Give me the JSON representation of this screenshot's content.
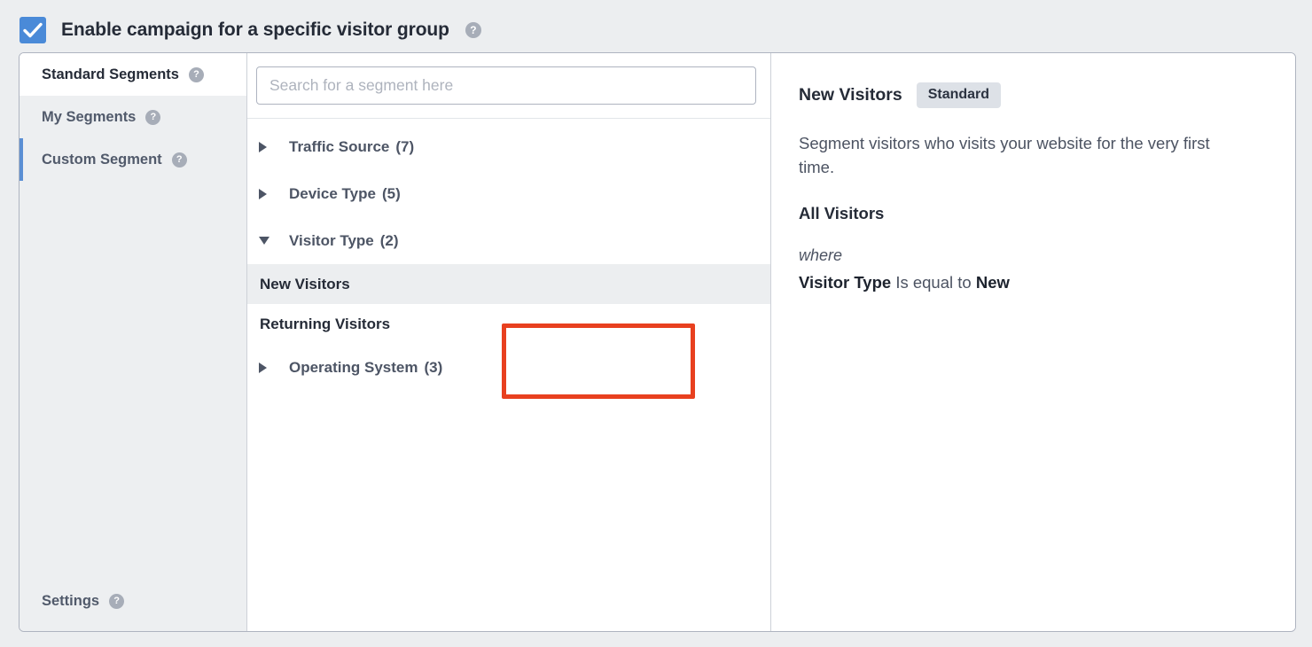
{
  "enable": {
    "label": "Enable campaign for a specific visitor group",
    "checked": true,
    "help": "?",
    "checkbox_color": "#4a8ad8"
  },
  "sidebar": {
    "items": [
      {
        "label": "Standard Segments",
        "help": "?",
        "active": true,
        "marked": false
      },
      {
        "label": "My Segments",
        "help": "?",
        "active": false,
        "marked": false
      },
      {
        "label": "Custom Segment",
        "help": "?",
        "active": false,
        "marked": true
      }
    ],
    "settings": {
      "label": "Settings",
      "help": "?"
    },
    "marker_color": "#5b8fd4"
  },
  "search": {
    "value": "",
    "placeholder": "Search for a segment here"
  },
  "tree": {
    "groups": [
      {
        "name": "Traffic Source",
        "count": "(7)",
        "expanded": false
      },
      {
        "name": "Device Type",
        "count": "(5)",
        "expanded": false
      },
      {
        "name": "Visitor Type",
        "count": "(2)",
        "expanded": true
      },
      {
        "name": "Operating System",
        "count": "(3)",
        "expanded": false
      }
    ],
    "visitor_type_children": [
      {
        "label": "New Visitors",
        "selected": true
      },
      {
        "label": "Returning Visitors",
        "selected": false
      }
    ]
  },
  "detail": {
    "title": "New Visitors",
    "badge": "Standard",
    "description": "Segment visitors who visits your website for the very first time.",
    "scope": "All Visitors",
    "where": "where",
    "rule_field": "Visitor Type",
    "rule_operator": " Is equal to ",
    "rule_value": "New"
  },
  "annotation": {
    "color": "#e8401f",
    "targets": [
      "New Visitors",
      "Returning Visitors"
    ]
  }
}
